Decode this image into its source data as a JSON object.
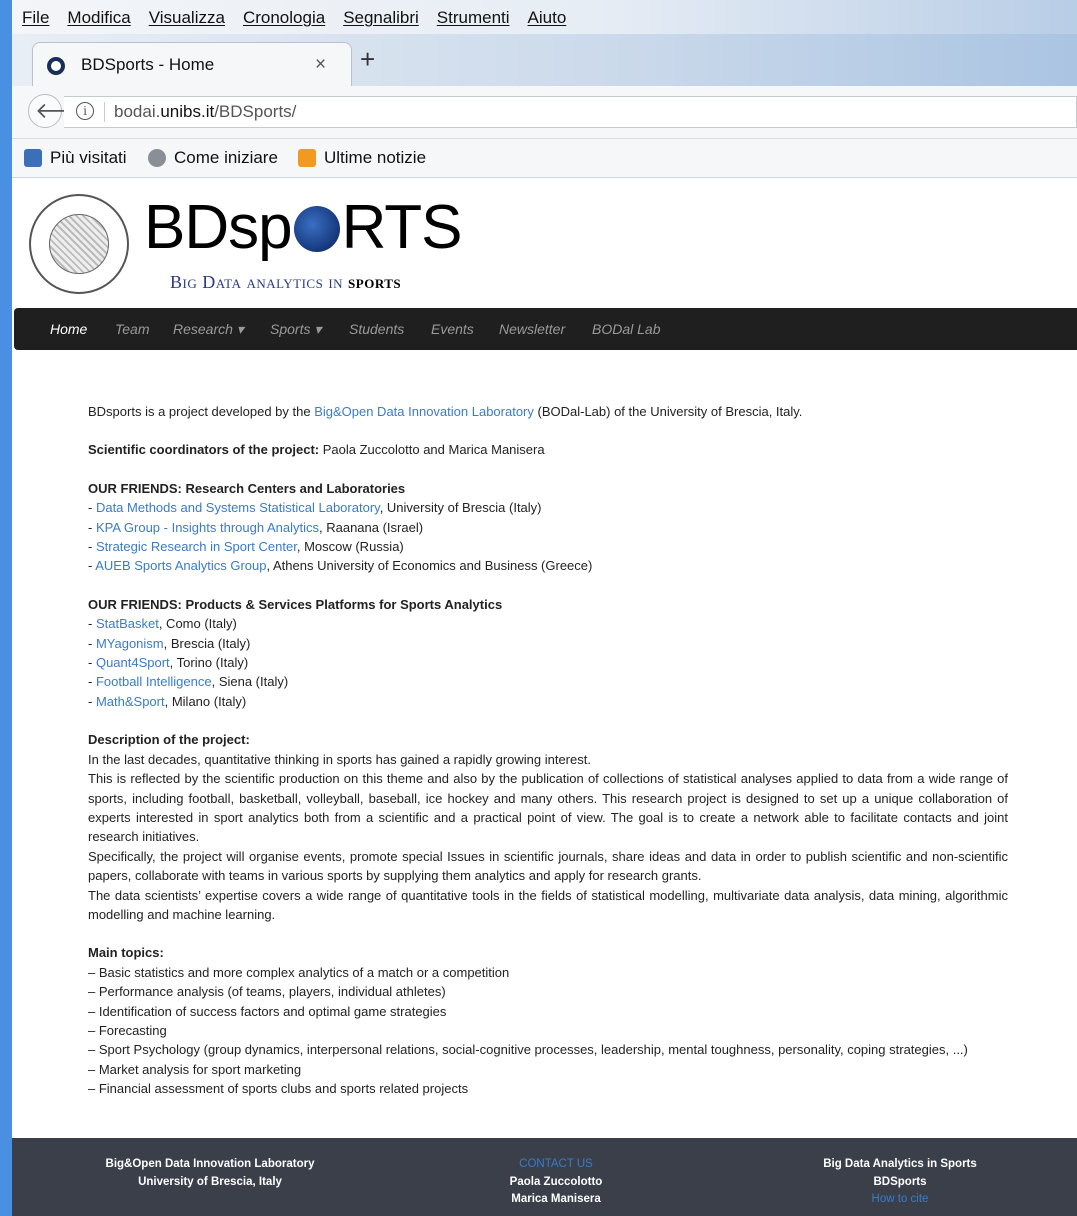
{
  "browser": {
    "menu": [
      "File",
      "Modifica",
      "Visualizza",
      "Cronologia",
      "Segnalibri",
      "Strumenti",
      "Aiuto"
    ],
    "tab_title": "BDSports - Home",
    "tab_close": "×",
    "new_tab": "+",
    "url_prefix": "bodai.",
    "url_domain": "unibs.it",
    "url_path": "/BDSports/",
    "bookmarks": [
      "Più visitati",
      "Come iniziare",
      "Ultime notizie"
    ]
  },
  "site": {
    "brand_a": "BDsp",
    "brand_b": "RTS",
    "tagline_a": "Big Data analytics in ",
    "tagline_b": "sports",
    "nav": [
      "Home",
      "Team",
      "Research ▾",
      "Sports ▾",
      "Students",
      "Events",
      "Newsletter",
      "BODal Lab"
    ]
  },
  "content": {
    "intro_pre": "BDsports is a project developed by the ",
    "intro_link": "Big&Open Data Innovation Laboratory",
    "intro_post": " (BODal-Lab) of the University of Brescia, Italy.",
    "coord_label": "Scientific coordinators of the project:",
    "coord_names": " Paola Zuccolotto and Marica Manisera",
    "friends1_heading": "OUR FRIENDS: Research Centers and Laboratories",
    "friends1": [
      {
        "link": "Data Methods and Systems Statistical Laboratory",
        "rest": ", University of Brescia (Italy)"
      },
      {
        "link": "KPA Group - Insights through Analytics",
        "rest": ", Raanana (Israel)"
      },
      {
        "link": "Strategic Research in Sport Center",
        "rest": ", Moscow (Russia)"
      },
      {
        "link": "AUEB Sports Analytics Group",
        "rest": ", Athens University of Economics and Business (Greece)"
      }
    ],
    "friends2_heading": "OUR FRIENDS: Products & Services Platforms for Sports Analytics",
    "friends2": [
      {
        "link": "StatBasket",
        "rest": ", Como (Italy)"
      },
      {
        "link": "MYagonism",
        "rest": ", Brescia (Italy)"
      },
      {
        "link": "Quant4Sport",
        "rest": ", Torino (Italy)"
      },
      {
        "link": "Football Intelligence",
        "rest": ", Siena (Italy)"
      },
      {
        "link": "Math&Sport",
        "rest": ", Milano (Italy)"
      }
    ],
    "desc_heading": "Description of the project:",
    "desc_p1": "In the last decades, quantitative thinking in sports has gained a rapidly growing interest.",
    "desc_p2": "This is reflected by the scientific production on this theme and also by the publication of collections of statistical analyses applied to data from a wide range of sports, including football, basketball, volleyball, baseball, ice hockey and many others. This research project is designed to set up a unique collaboration of experts interested in sport analytics both from a scientific and a practical point of view. The goal is to create a network able to facilitate contacts and joint research initiatives.",
    "desc_p3": "Specifically, the project will organise events, promote special Issues in scientific journals, share ideas and data in order to publish scientific and non-scientific papers, collaborate with teams in various sports by supplying them analytics and apply for research grants.",
    "desc_p4": "The data scientists’ expertise covers a wide range of quantitative tools in the fields of statistical modelling, multivariate data analysis, data mining, algorithmic modelling and machine learning.",
    "topics_heading": "Main topics:",
    "topics": [
      "– Basic statistics and more complex analytics of a match or a competition",
      "– Performance analysis (of teams, players, individual athletes)",
      "– Identification of success factors and optimal game strategies",
      "– Forecasting",
      "– Sport Psychology (group dynamics, interpersonal relations, social-cognitive processes, leadership, mental toughness, personality, coping strategies, ...)",
      "– Market analysis for sport marketing",
      "– Financial assessment of sports clubs and sports related projects"
    ]
  },
  "footer": {
    "col1": [
      "Big&Open Data Innovation Laboratory",
      "University of Brescia, Italy"
    ],
    "contact": "CONTACT US",
    "col2": [
      "Paola Zuccolotto",
      "Marica Manisera"
    ],
    "col3": [
      "Big Data Analytics in Sports",
      "BDSports"
    ],
    "cite": "How to cite"
  },
  "colors": {
    "link": "#3a7bc8",
    "nav_bg": "#1f1f1f",
    "footer_bg": "#3a3f4a",
    "desktop": "#4a90e2"
  }
}
